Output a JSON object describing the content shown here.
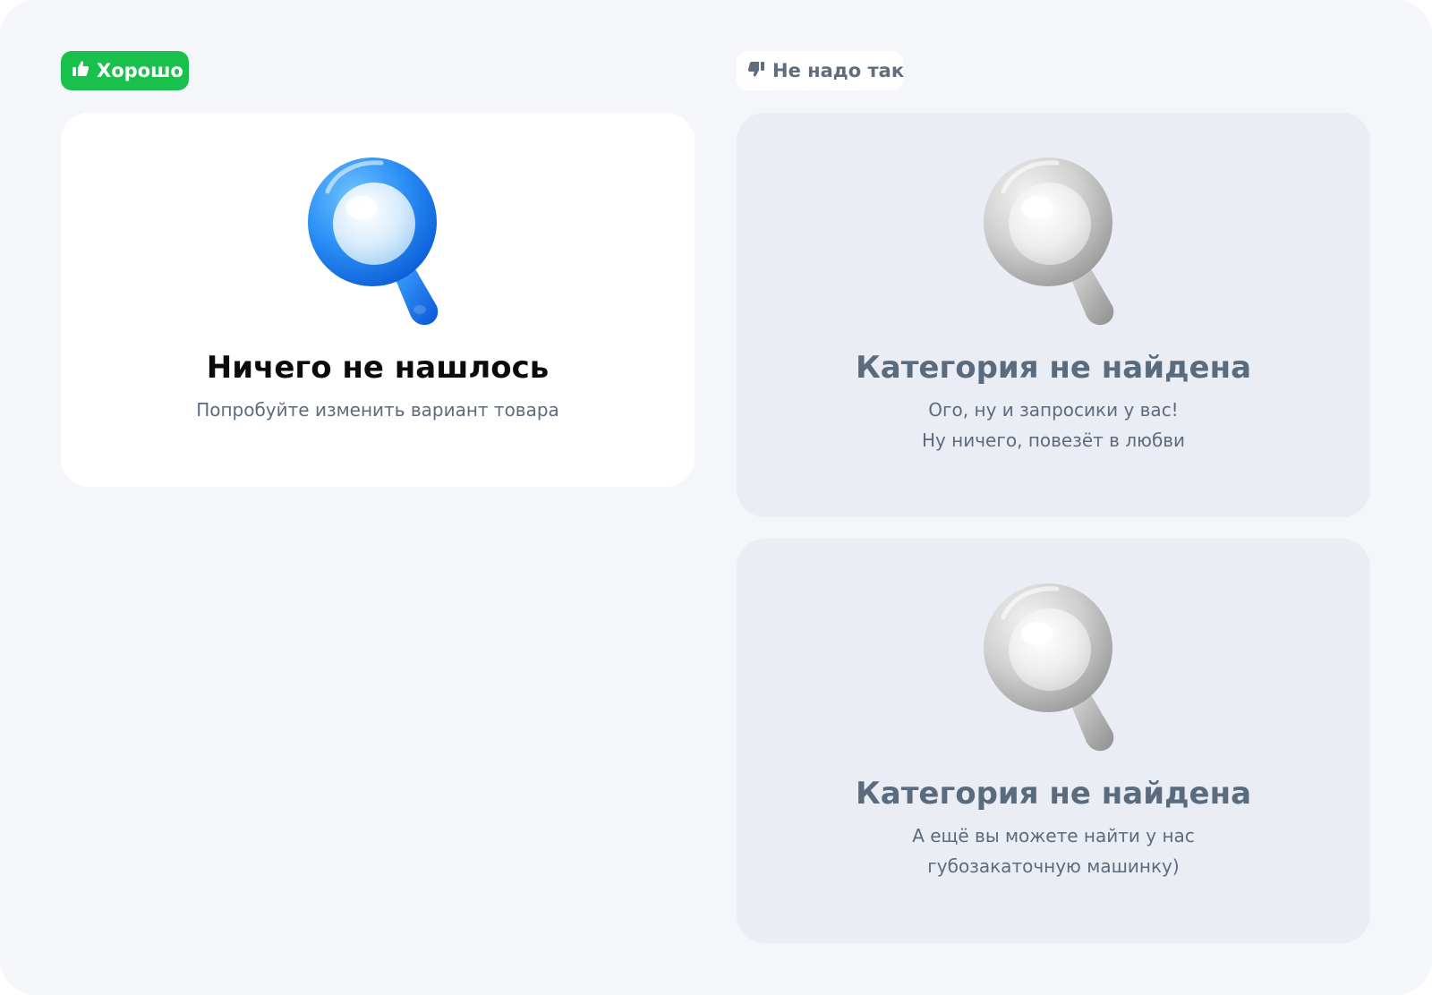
{
  "colors": {
    "background": "#f5f6f9",
    "good_accent": "#19c14c",
    "bad_card": "#eaedf4",
    "text_muted": "#5e6b7c",
    "good_icon_blue": "#1e88f5",
    "bad_icon_gray": "#b8b8b8"
  },
  "good": {
    "badge_label": "Хорошо",
    "badge_icon": "thumbs-up-icon",
    "card": {
      "icon": "magnifier-blue-icon",
      "title": "Ничего не нашлось",
      "text": [
        "Попробуйте изменить вариант товара"
      ]
    }
  },
  "bad": {
    "badge_label": "Не надо так",
    "badge_icon": "thumbs-down-icon",
    "cards": [
      {
        "icon": "magnifier-gray-icon",
        "title": "Категория не найдена",
        "text": [
          "Ого, ну и запросики у вас!",
          "Ну ничего, повезёт в любви"
        ]
      },
      {
        "icon": "magnifier-gray-icon",
        "title": "Категория не найдена",
        "text": [
          "А ещё вы можете найти у нас",
          "губозакаточную машинку)"
        ]
      }
    ]
  }
}
